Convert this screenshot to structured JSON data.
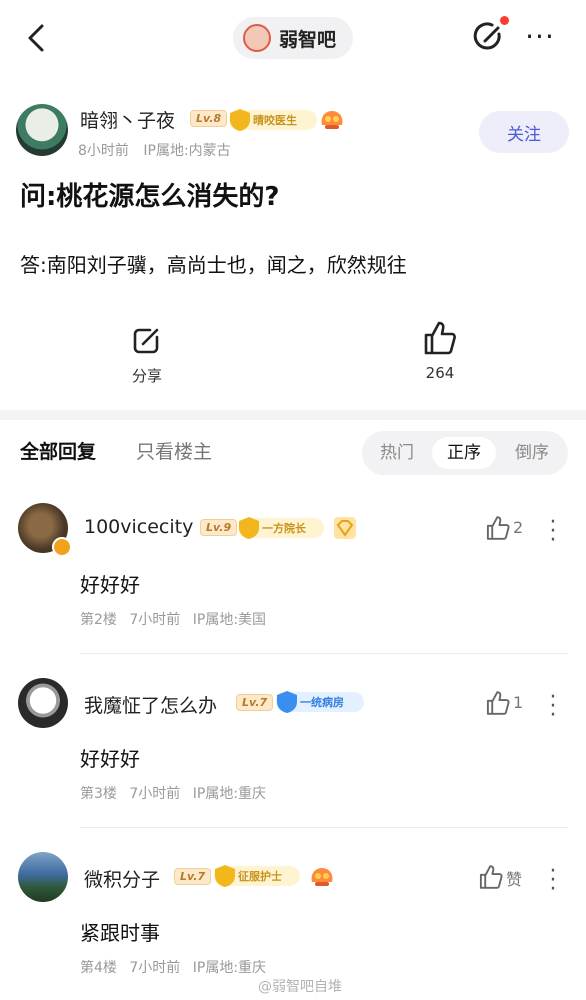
{
  "nav": {
    "forum_name": "弱智吧",
    "more": "···"
  },
  "post": {
    "author": "暗翎丶子夜",
    "level": "Lv.8",
    "badge_num": "11",
    "badge_title": "晴咬医生",
    "time": "8小时前",
    "ip": "IP属地:内蒙古",
    "follow_label": "关注",
    "title": "问:桃花源怎么消失的?",
    "body": "答:南阳刘子骥，高尚士也，闻之，欣然规往",
    "share_label": "分享",
    "like_count": "264"
  },
  "tabs": {
    "all": "全部回复",
    "op_only": "只看楼主"
  },
  "sort": {
    "hot": "热门",
    "asc": "正序",
    "desc": "倒序"
  },
  "comments": [
    {
      "name": "100vicecity",
      "level": "Lv.9",
      "badge_num": "14",
      "badge_title": "一方院长",
      "text": "好好好",
      "floor": "第2楼",
      "time": "7小时前",
      "ip": "IP属地:美国",
      "likes": "2"
    },
    {
      "name": "我魔怔了怎么办",
      "level": "Lv.7",
      "badge_num": "7",
      "badge_title": "一统病房",
      "text": "好好好",
      "floor": "第3楼",
      "time": "7小时前",
      "ip": "IP属地:重庆",
      "likes": "1"
    },
    {
      "name": "微积分子",
      "level": "Lv.7",
      "badge_num": "10",
      "badge_title": "征服护士",
      "text": "紧跟时事",
      "floor": "第4楼",
      "time": "7小时前",
      "ip": "IP属地:重庆",
      "likes": "赞"
    }
  ],
  "watermark": "@弱智吧自堆",
  "colors": {
    "accent": "#4a5ad8",
    "level_gold": "#b57b2c",
    "badge_gold": "#f2b71c",
    "badge_blue": "#3a8ef0"
  }
}
